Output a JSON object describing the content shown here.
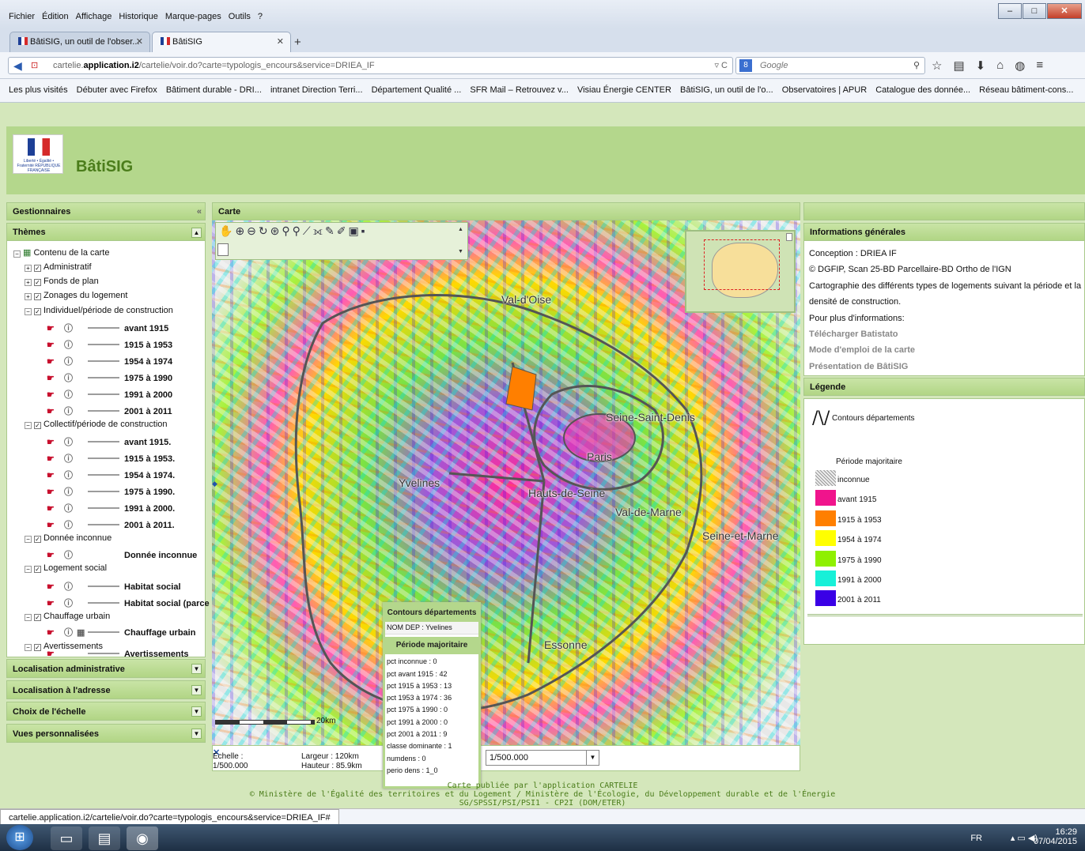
{
  "browser": {
    "menu": [
      "Fichier",
      "Édition",
      "Affichage",
      "Historique",
      "Marque-pages",
      "Outils",
      "?"
    ],
    "tabs": [
      {
        "label": "BâtiSIG, un outil de l'obser..."
      },
      {
        "label": "BâtiSIG"
      }
    ],
    "url_prefix": "cartelie.",
    "url_host": "application.i2",
    "url_rest": "/cartelie/voir.do?carte=typologis_encours&service=DRIEA_IF",
    "search_placeholder": "Google",
    "bookmarks": [
      "Les plus visités",
      "Débuter avec Firefox",
      "Bâtiment durable - DRI...",
      "intranet Direction Terri...",
      "Département Qualité ...",
      "SFR Mail – Retrouvez v...",
      "Visiau Énergie CENTER",
      "BâtiSIG, un outil de l'o...",
      "Observatoires | APUR",
      "Catalogue des donnée...",
      "Réseau bâtiment-cons..."
    ]
  },
  "app": {
    "title": "BâtiSIG",
    "logo_text": "Liberté • Égalité • Fraternité RÉPUBLIQUE FRANÇAISE"
  },
  "left": {
    "gestionnaires": "Gestionnaires",
    "themes": "Thèmes",
    "root": "Contenu de la carte",
    "groups": [
      "Administratif",
      "Fonds de plan",
      "Zonages du logement"
    ],
    "individuel": {
      "title": "Individuel/période de construction",
      "layers": [
        "avant 1915",
        "1915 à 1953",
        "1954 à 1974",
        "1975 à 1990",
        "1991 à 2000",
        "2001 à 2011"
      ]
    },
    "collectif": {
      "title": "Collectif/période de construction",
      "layers": [
        "avant 1915.",
        "1915 à 1953.",
        "1954 à 1974.",
        "1975 à 1990.",
        "1991 à 2000.",
        "2001 à 2011."
      ]
    },
    "inconnue": {
      "title": "Donnée inconnue",
      "layers": [
        "Donnée inconnue"
      ]
    },
    "social": {
      "title": "Logement social",
      "layers": [
        "Habitat social",
        "Habitat social (parce"
      ]
    },
    "chauffage": {
      "title": "Chauffage urbain",
      "layers": [
        "Chauffage urbain"
      ]
    },
    "avert": {
      "title": "Avertissements",
      "layers": [
        "Avertissements"
      ]
    },
    "panels": [
      "Localisation administrative",
      "Localisation à l'adresse",
      "Choix de l'échelle",
      "Vues personnalisées"
    ]
  },
  "map": {
    "title": "Carte",
    "labels": [
      "Val-d'Oise",
      "Seine-Saint-Denis",
      "Paris",
      "Yvelines",
      "Hauts-de-Seine",
      "Val-de-Marne",
      "Seine-et-Marne",
      "Essonne"
    ],
    "scale_text": "20km",
    "echelle_label": "Échelle :",
    "echelle_value": "1/500.000",
    "largeur": "Largeur : 120km",
    "hauteur": "Hauteur : 85.9km",
    "scale_select": "1/500.000"
  },
  "popup": {
    "header1": "Contours départements",
    "nom_dep": "NOM DEP : Yvelines",
    "header2": "Période majoritaire",
    "lines": [
      "pct inconnue : 0",
      "pct avant 1915 : 42",
      "pct 1915 à 1953 : 13",
      "pct 1953 à 1974 : 36",
      "pct 1975 à 1990 : 0",
      "pct 1991 à 2000 : 0",
      "pct 2001 à 2011 : 9",
      "classe dominante : 1",
      "numdens : 0",
      "perio dens : 1_0"
    ]
  },
  "right": {
    "info_title": "Informations générales",
    "info_lines": [
      "Conception : DRIEA IF",
      "© DGFIP, Scan 25-BD Parcellaire-BD Ortho de l'IGN",
      "Cartographie des différents types de logements suivant la période et la",
      "densité de construction.",
      "Pour plus d'informations:"
    ],
    "links": [
      "Télécharger Batistato",
      "Mode d'emploi de la carte",
      "Présentation de BâtiSIG"
    ],
    "legend_title": "Légende",
    "legend_contours": "Contours départements",
    "legend_periode": "Période majoritaire",
    "legend_items": [
      {
        "label": "inconnue",
        "color": "#d8d8d8"
      },
      {
        "label": "avant 1915",
        "color": "#f0148c"
      },
      {
        "label": "1915 à 1953",
        "color": "#ff7f00"
      },
      {
        "label": "1954 à 1974",
        "color": "#ffff00"
      },
      {
        "label": "1975 à 1990",
        "color": "#8ff000"
      },
      {
        "label": "1991 à 2000",
        "color": "#17f0d8"
      },
      {
        "label": "2001 à 2011",
        "color": "#3a00e6"
      }
    ]
  },
  "footer": {
    "line1": "Carte publiée par l'application CARTELIE",
    "line2": "© Ministère de l'Égalité des territoires et du Logement / Ministère de l'Écologie, du Développement durable et de l'Énergie",
    "line3": "SG/SPSSI/PSI/PSI1 - CP2I (DOM/ETER)"
  },
  "status": "cartelie.application.i2/cartelie/voir.do?carte=typologis_encours&service=DRIEA_IF#",
  "tray": {
    "lang": "FR",
    "time": "16:29",
    "date": "07/04/2015"
  }
}
